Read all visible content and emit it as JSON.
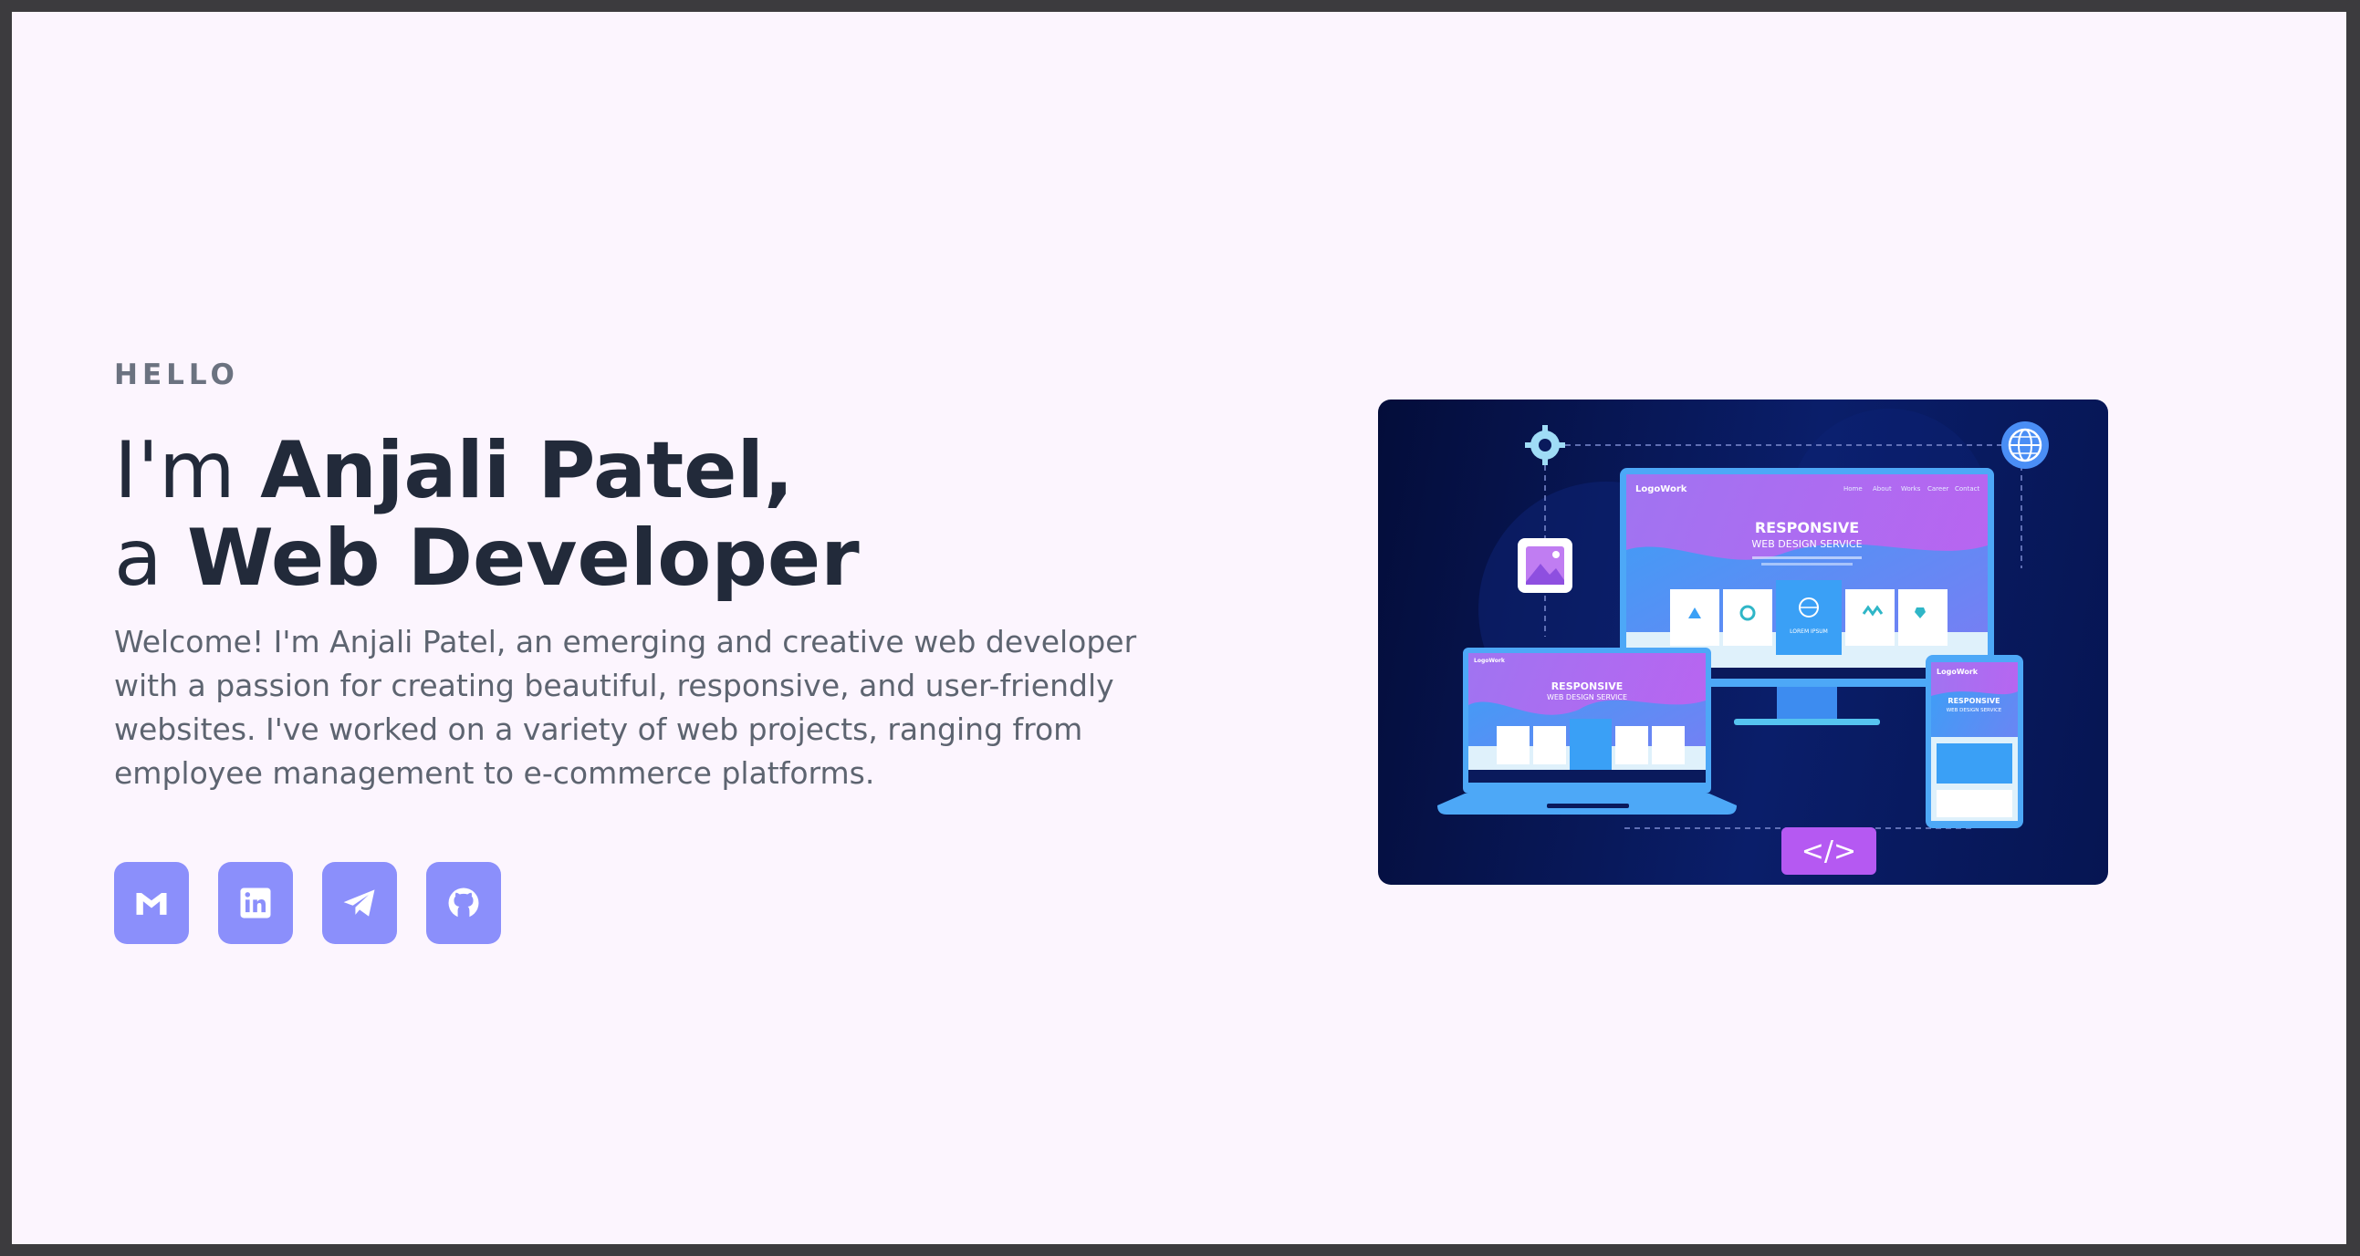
{
  "hero": {
    "eyebrow": "HELLO",
    "line1_prefix": "I'm ",
    "line1_name": "Anjali Patel,",
    "line2_prefix": "a ",
    "line2_role": "Web Developer",
    "intro": "Welcome! I'm Anjali Patel, an emerging and creative web developer with a passion for creating beautiful, responsive, and user-friendly websites. I've worked on a variety of web projects, ranging from employee management to e-commerce platforms."
  },
  "socials": [
    {
      "icon": "gmail-icon"
    },
    {
      "icon": "linkedin-icon"
    },
    {
      "icon": "telegram-icon"
    },
    {
      "icon": "github-icon"
    }
  ],
  "illustration": {
    "logo": "LogoWork",
    "headline": "RESPONSIVE",
    "subheadline": "WEB DESIGN SERVICE",
    "nav": [
      "Home",
      "About",
      "Works",
      "Career",
      "Contact"
    ],
    "card_label": "LOREM IPSUM",
    "code_tag": "</>"
  },
  "colors": {
    "page_background": "#fcf5fe",
    "frame": "#3c3b3e",
    "accent": "#8b8ffb",
    "heading": "#222a3a",
    "body_text": "#5d6470"
  }
}
